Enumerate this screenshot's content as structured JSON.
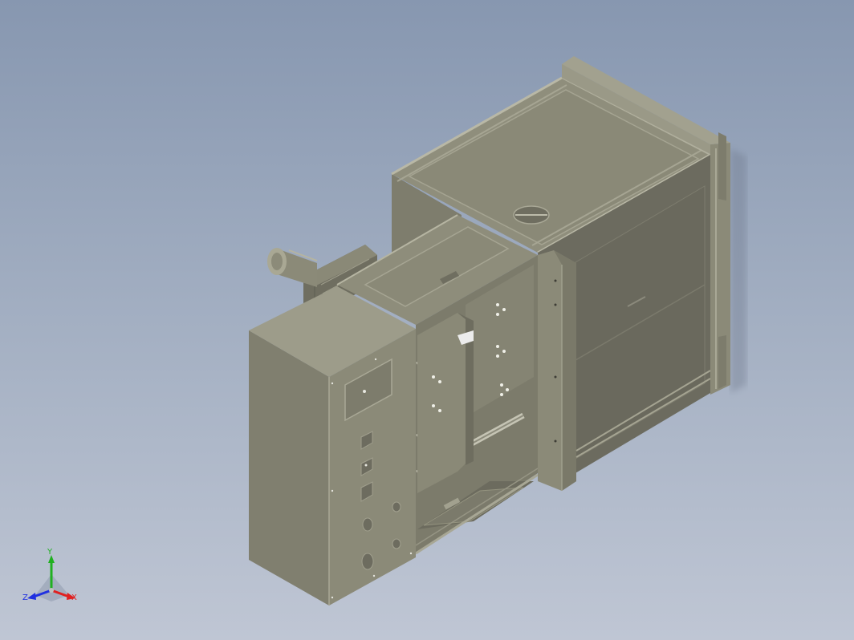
{
  "viewer": {
    "background_top": "#8797b0",
    "background_bottom": "#bfc6d4",
    "model_color": "#8e8d7b"
  },
  "triad": {
    "x_label": "X",
    "y_label": "Y",
    "z_label": "Z",
    "x_color": "#e02020",
    "y_color": "#20b020",
    "z_color": "#2030e0"
  }
}
